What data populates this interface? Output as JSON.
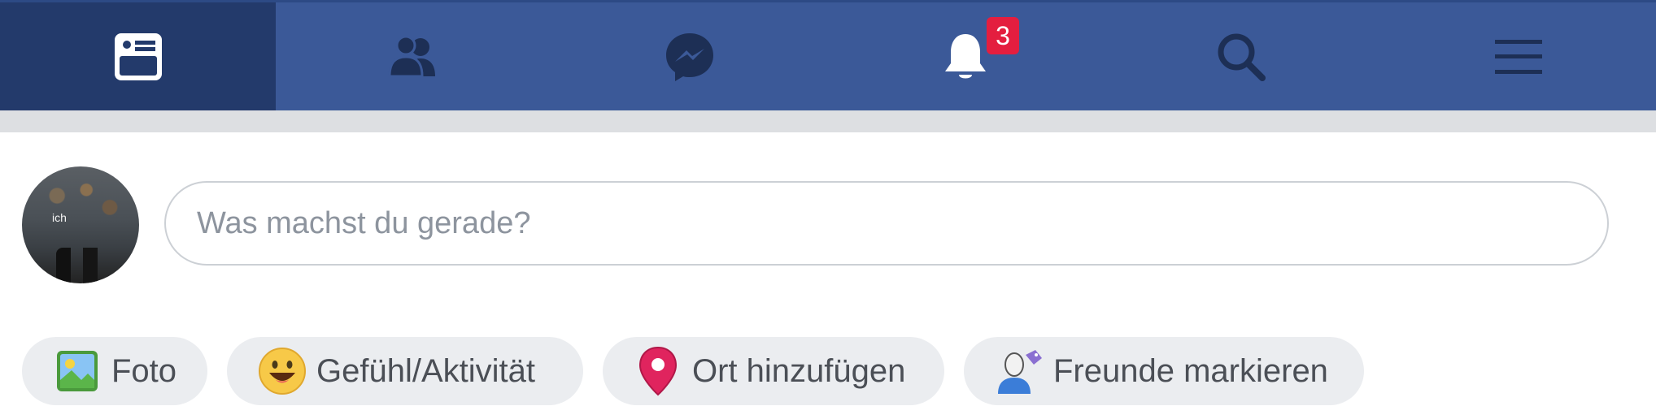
{
  "nav": {
    "tabs": [
      {
        "name": "news-feed",
        "icon": "news-feed-icon",
        "active": true
      },
      {
        "name": "friends",
        "icon": "friends-icon",
        "active": false
      },
      {
        "name": "messenger",
        "icon": "messenger-icon",
        "active": false
      },
      {
        "name": "notifications",
        "icon": "bell-icon",
        "active": false,
        "badge": "3"
      },
      {
        "name": "search",
        "icon": "search-icon",
        "active": false
      },
      {
        "name": "menu",
        "icon": "hamburger-menu-icon",
        "active": false
      }
    ],
    "badge_count": "3",
    "colors": {
      "bar": "#3b5998",
      "active": "#233a6b",
      "badge": "#e41e3f"
    }
  },
  "composer": {
    "avatar_caption": "ich",
    "placeholder": "Was machst du gerade?",
    "actions": [
      {
        "label": "Foto",
        "icon": "photo-icon"
      },
      {
        "label": "Gefühl/Aktivität",
        "icon": "smiley-icon"
      },
      {
        "label": "Ort hinzufügen",
        "icon": "location-pin-icon"
      },
      {
        "label": "Freunde markieren",
        "icon": "tag-friends-icon"
      }
    ]
  }
}
